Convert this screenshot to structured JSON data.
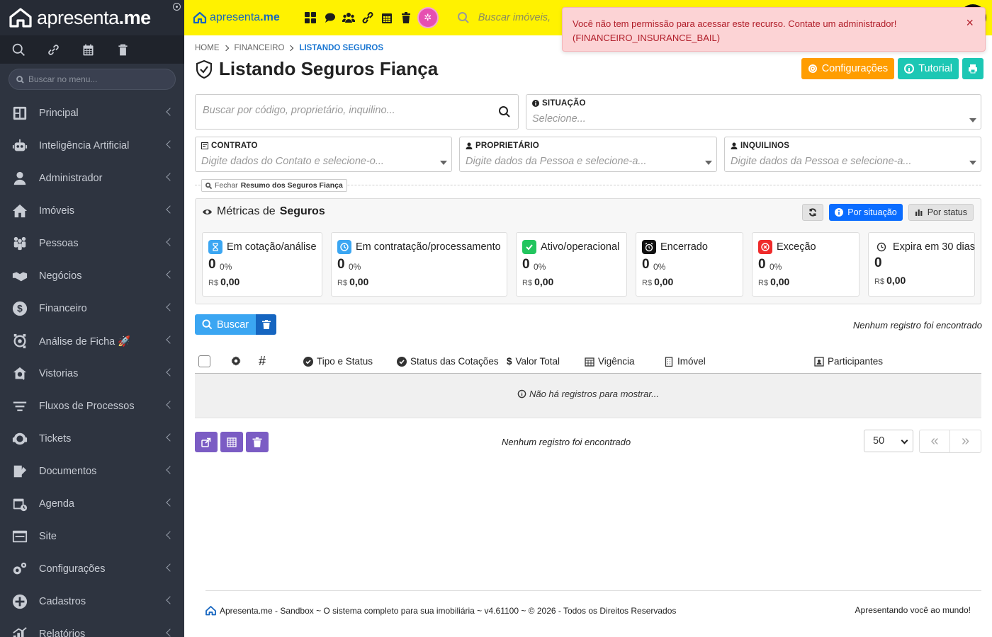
{
  "brand": {
    "name_light": "apresenta",
    "name_bold": ".me"
  },
  "sidebar": {
    "search_placeholder": "Buscar no menu...",
    "tools": [
      "search-icon",
      "link-icon",
      "calendar-icon",
      "trash-icon"
    ],
    "items": [
      {
        "label": "Principal",
        "icon": "dashboard-icon"
      },
      {
        "label": "Inteligência Artificial",
        "icon": "robot-icon"
      },
      {
        "label": "Administrador",
        "icon": "admin-user-icon"
      },
      {
        "label": "Imóveis",
        "icon": "home-icon"
      },
      {
        "label": "Pessoas",
        "icon": "people-icon"
      },
      {
        "label": "Negócios",
        "icon": "handshake-icon"
      },
      {
        "label": "Financeiro",
        "icon": "dollar-icon"
      },
      {
        "label": "Análise de Ficha 🚀",
        "icon": "analysis-icon"
      },
      {
        "label": "Vistorias",
        "icon": "inspection-icon"
      },
      {
        "label": "Fluxos de Processos",
        "icon": "flow-icon"
      },
      {
        "label": "Tickets",
        "icon": "support-icon"
      },
      {
        "label": "Documentos",
        "icon": "document-icon"
      },
      {
        "label": "Agenda",
        "icon": "agenda-icon"
      },
      {
        "label": "Site",
        "icon": "site-icon"
      },
      {
        "label": "Configurações",
        "icon": "gears-icon"
      },
      {
        "label": "Cadastros",
        "icon": "plus-circle-icon"
      },
      {
        "label": "Relatórios",
        "icon": "chart-icon"
      }
    ]
  },
  "topbar": {
    "logo_light": "apresenta",
    "logo_bold": ".me",
    "search_placeholder": "Buscar imóveis,",
    "icons": [
      "grid-icon",
      "chat-icon",
      "users-icon",
      "link-icon",
      "calendar-icon",
      "trash-icon",
      "pink-badge-icon"
    ]
  },
  "alert": {
    "message": "Você não tem permissão para acessar este recurso. Contate um administrador!",
    "code": "(FINANCEIRO_INSURANCE_BAIL)",
    "close": "×"
  },
  "breadcrumb": {
    "items": [
      "HOME",
      "FINANCEIRO",
      "LISTANDO SEGUROS"
    ]
  },
  "page": {
    "title_light": "Listando",
    "title_bold": "Seguros Fiança",
    "config_label": "Configurações",
    "tutorial_label": "Tutorial"
  },
  "filters": {
    "search_placeholder": "Buscar por código, proprietário, inquilino...",
    "situacao": {
      "label": "SITUAÇÃO",
      "placeholder": "Selecione..."
    },
    "contrato": {
      "label": "CONTRATO",
      "placeholder": "Digite dados do Contato e selecione-o..."
    },
    "proprietario": {
      "label": "PROPRIETÁRIO",
      "placeholder": "Digite dados da Pessoa e selecione-a..."
    },
    "inquilinos": {
      "label": "INQUILINOS",
      "placeholder": "Digite dados da Pessoa e selecione-a..."
    }
  },
  "summary_toggle": {
    "prefix": "Fechar",
    "bold": "Resumo dos Seguros Fiança"
  },
  "metrics": {
    "title_light": "Métricas de",
    "title_bold": "Seguros",
    "by_situation": "Por situação",
    "by_status": "Por status",
    "cards": [
      {
        "title": "Em cotação/análise",
        "count": "0",
        "pct": "0%",
        "currency": "R$",
        "value": "0,00",
        "color": "#3ba6f2",
        "icon": "hourglass-icon"
      },
      {
        "title": "Em contratação/processamento",
        "count": "0",
        "pct": "0%",
        "currency": "R$",
        "value": "0,00",
        "color": "#3ba6f2",
        "icon": "clock-icon"
      },
      {
        "title": "Ativo/operacional",
        "count": "0",
        "pct": "0%",
        "currency": "R$",
        "value": "0,00",
        "color": "#22c55e",
        "icon": "check-icon"
      },
      {
        "title": "Encerrado",
        "count": "0",
        "pct": "0%",
        "currency": "R$",
        "value": "0,00",
        "color": "#111111",
        "icon": "alarm-icon"
      },
      {
        "title": "Exceção",
        "count": "0",
        "pct": "0%",
        "currency": "R$",
        "value": "0,00",
        "color": "#ef2b2b",
        "icon": "x-circle-icon"
      },
      {
        "title": "Expira em 30 dias",
        "count": "0",
        "pct": "",
        "currency": "R$",
        "value": "0,00",
        "color": "#ffffff",
        "icon": "clock-outline-icon"
      }
    ]
  },
  "actions": {
    "search_label": "Buscar",
    "no_records": "Nenhum registro foi encontrado"
  },
  "table": {
    "columns": [
      "#",
      "Tipo e Status",
      "Status das Cotações",
      "Valor Total",
      "Vigência",
      "Imóvel",
      "Participantes"
    ],
    "empty": "Não há registros para mostrar..."
  },
  "pagination": {
    "no_records": "Nenhum registro foi encontrado",
    "per_page": "50",
    "first": "«",
    "next": "»"
  },
  "footer": {
    "left": "Apresenta.me - Sandbox ~ O sistema completo para sua imobiliária ~ v4.61100 ~ © 2026 - Todos os Direitos Reservados",
    "right": "Apresentando você ao mundo!"
  }
}
